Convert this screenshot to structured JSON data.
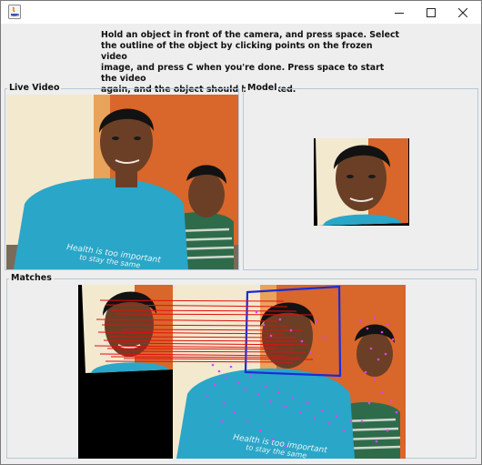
{
  "window": {
    "title_icon": "java-icon",
    "controls": [
      "minimize-icon",
      "maximize-icon",
      "close-icon"
    ]
  },
  "instructions": "Hold an object in front of the camera, and press space. Select\nthe outline of the object by clicking points on the frozen video\nimage, and press C when you're done. Press space to start the video\nagain, and the object should be tracked.",
  "panels": {
    "live_video": {
      "label": "Live Video"
    },
    "model": {
      "label": "Model"
    },
    "matches": {
      "label": "Matches"
    }
  },
  "shirt_print": {
    "line1": "Health is too important",
    "line2": "to stay the same"
  },
  "colors": {
    "match_lines": "#e01010",
    "tracking_box": "#1a2bd8",
    "keypoints": "#e040ff",
    "wall": "#d9662a",
    "shirt": "#2aa6c8"
  }
}
